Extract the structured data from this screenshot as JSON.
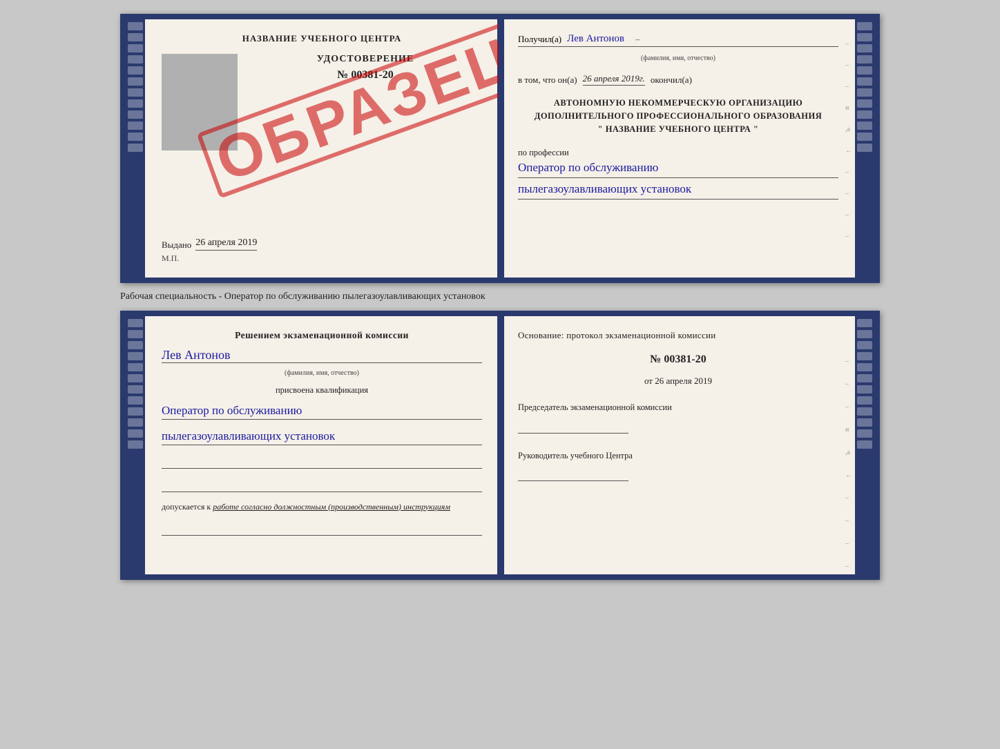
{
  "background": "#c8c8c8",
  "page": {
    "specialtyLabel": "Рабочая специальность - Оператор по обслуживанию пылегазоулавливающих установок"
  },
  "cert": {
    "schoolName": "НАЗВАНИЕ УЧЕБНОГО ЦЕНТРА",
    "obrazec": "ОБРАЗЕЦ",
    "udostoverenie": "УДОСТОВЕРЕНИЕ",
    "number": "№ 00381-20",
    "vydanoLabel": "Выдано",
    "vydanoDate": "26 апреля 2019",
    "mp": "М.П.",
    "right": {
      "poluchilLabel": "Получил(а)",
      "recipientName": "Лев Антонов",
      "fioSub": "(фамилия, имя, отчество)",
      "vtomLabel": "в том, что он(а)",
      "date": "26 апреля 2019г.",
      "okoncilLabel": "окончил(а)",
      "orgLine1": "АВТОНОМНУЮ НЕКОММЕРЧЕСКУЮ ОРГАНИЗАЦИЮ",
      "orgLine2": "ДОПОЛНИТЕЛЬНОГО ПРОФЕССИОНАЛЬНОГО ОБРАЗОВАНИЯ",
      "orgLine3": "\"  НАЗВАНИЕ УЧЕБНОГО ЦЕНТРА  \"",
      "professiyaLabel": "по профессии",
      "professiyaLine1": "Оператор по обслуживанию",
      "professiyaLine2": "пылегазоулавливающих установок"
    }
  },
  "qual": {
    "left": {
      "decisionLabel": "Решением экзаменационной комиссии",
      "personName": "Лев Антонов",
      "fioSub": "(фамилия, имя, отчество)",
      "prisvoenaLabel": "присвоена квалификация",
      "qualLine1": "Оператор по обслуживанию",
      "qualLine2": "пылегазоулавливающих установок",
      "dopuskaetsyaLabel": "допускается к",
      "dopuskaetsyaText": "работе согласно должностным (производственным) инструкциям"
    },
    "right": {
      "osnovaniyeLabel": "Основание: протокол экзаменационной комиссии",
      "protocolNumber": "№ 00381-20",
      "otLabel": "от",
      "otDate": "26 апреля 2019",
      "predsedatelLabel": "Председатель экзаменационной комиссии",
      "rukovoditelLabel": "Руководитель учебного Центра"
    }
  },
  "sidemarksRight": [
    "-",
    "-",
    "-",
    "и",
    ",а",
    "←",
    "-",
    "-",
    "-",
    "-"
  ]
}
